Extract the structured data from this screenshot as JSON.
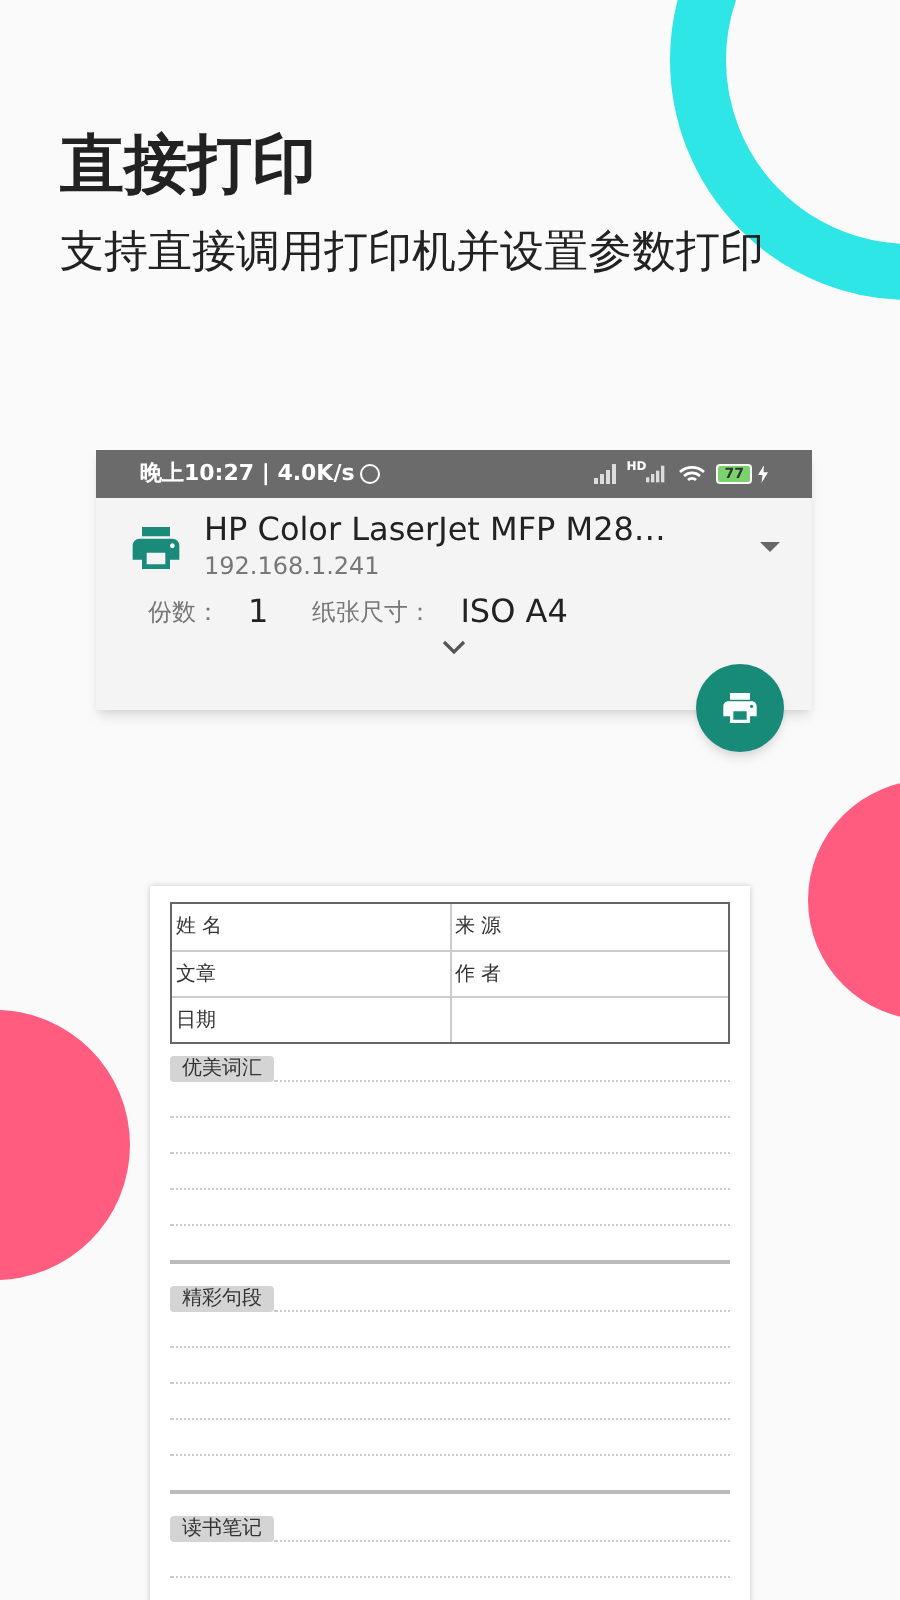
{
  "heading": {
    "title": "直接打印",
    "subtitle": "支持直接调用打印机并设置参数打印"
  },
  "status_bar": {
    "time": "晚上10:27 | 4.0K/s",
    "network_label": "HD",
    "battery": "77"
  },
  "printer": {
    "name": "HP Color LaserJet MFP M28…",
    "address": "192.168.1.241"
  },
  "settings": [
    {
      "label": "份数：",
      "value": "1"
    },
    {
      "label": "纸张尺寸：",
      "value": "ISO A4"
    }
  ],
  "document": {
    "table": [
      [
        "姓 名",
        "来 源"
      ],
      [
        "文章",
        "作 者"
      ],
      [
        "日期"
      ]
    ],
    "sections": [
      {
        "label": "优美词汇"
      },
      {
        "label": "精彩句段"
      },
      {
        "label": "读书笔记"
      }
    ]
  }
}
